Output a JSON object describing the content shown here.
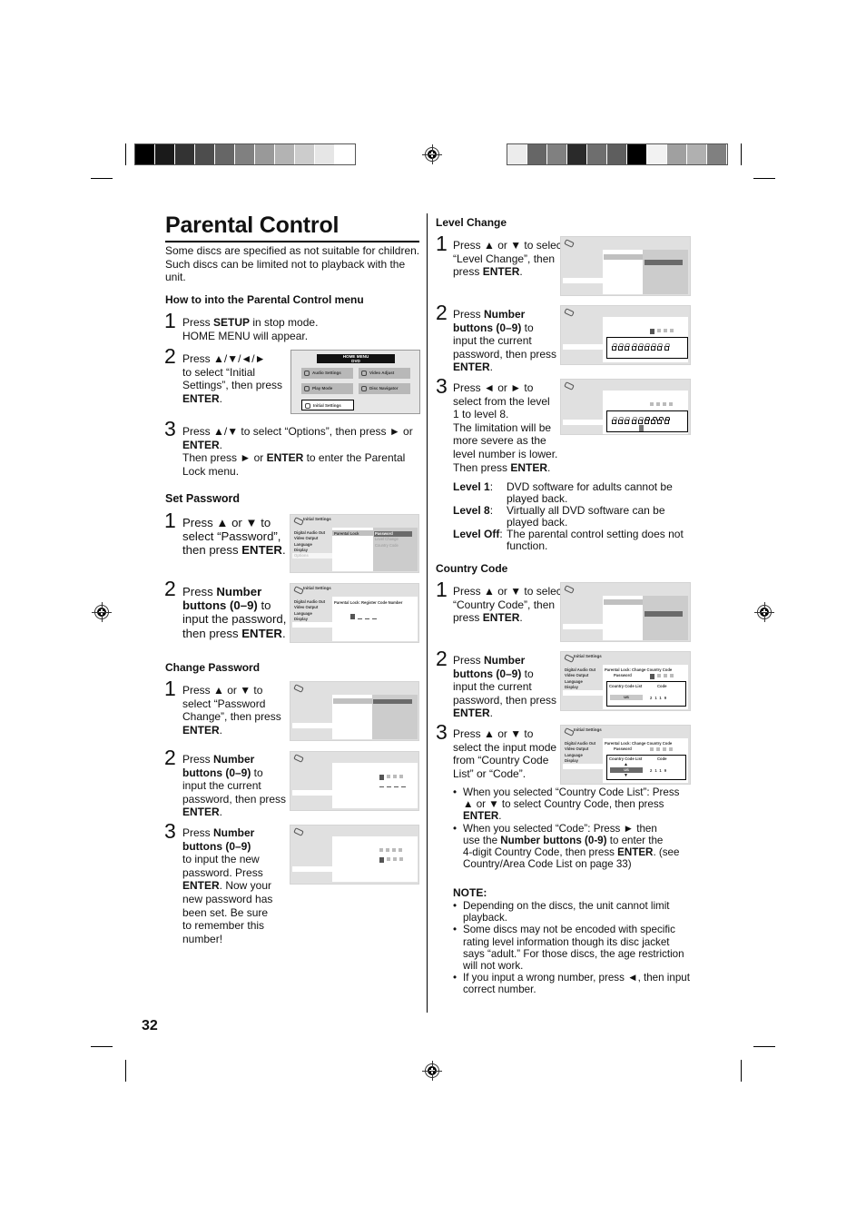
{
  "page": {
    "title": "Parental Control",
    "intro": "Some discs are specified as not suitable for children. Such discs can be limited not to playback with the unit.",
    "page_number": "32",
    "swatches_left": [
      "#000000",
      "#1a1a1a",
      "#333333",
      "#4d4d4d",
      "#666666",
      "#808080",
      "#999999",
      "#b3b3b3",
      "#cccccc",
      "#e6e6e6",
      "#ffffff"
    ],
    "swatches_right": [
      "#ececec",
      "#666666",
      "#808080",
      "#2a2a2a",
      "#6e6e6e",
      "#5e5e5e",
      "#000000",
      "#f2f2f2",
      "#a0a0a0",
      "#b0b0b0",
      "#808080"
    ]
  },
  "how_to": {
    "heading": "How to into the Parental Control menu",
    "steps": [
      {
        "num": "1",
        "pre": "Press ",
        "bold": "SETUP",
        "post": " in stop mode.",
        "line2": "HOME MENU will appear."
      },
      {
        "num": "2",
        "pre": "Press ▲/▼/◄/►",
        "line2": "to select “Initial",
        "line3": "Settings”, then press",
        "bold": "ENTER",
        "post": "."
      },
      {
        "num": "3",
        "pre": "Press ▲/▼ to select “Options”, then press ► or",
        "bold": "ENTER",
        "post": ".",
        "line3a": "Then press ► or ",
        "bold2": "ENTER",
        "line3b": " to enter the Parental",
        "line4": "Lock menu."
      }
    ],
    "home_menu": {
      "title": "HOME MENU",
      "subtitle": "DVD",
      "buttons": [
        "Audio Settings",
        "Video Adjust",
        "Play Mode",
        "Disc Navigator",
        "Initial Settings"
      ]
    }
  },
  "screen_common": {
    "title": "Initial Settings",
    "side_items": [
      "Digital Audio Out",
      "Video Output",
      "Language",
      "Display",
      "Options"
    ],
    "parental_lock": "Parental Lock",
    "sub_items": [
      "Password",
      "Level Change",
      "Country Code"
    ],
    "register_code": "Parental Lock: Register Code Number",
    "change_country": "Parental Lock: Change Country Code",
    "password_label": "Password",
    "country_list_label": "Country Code List",
    "code_label": "Code",
    "country_value": "US",
    "code_digits": [
      "2",
      "1",
      "1",
      "9"
    ]
  },
  "set_password": {
    "heading": "Set Password",
    "step1": {
      "num": "1",
      "l1": "Press ▲ or ▼ to",
      "l2": "select “Password”,",
      "l3": "then press ",
      "bold": "ENTER",
      "post": "."
    },
    "step2": {
      "num": "2",
      "l1a": "Press ",
      "bold1": "Number",
      "bold2": "buttons (0–9)",
      "l2b": " to",
      "l3": "input the password,",
      "l4": "then press ",
      "bold3": "ENTER",
      "post": "."
    }
  },
  "change_password": {
    "heading": "Change Password",
    "step1": {
      "num": "1",
      "l1": "Press ▲ or ▼ to",
      "l2": "select “Password",
      "l3": "Change”, then press",
      "bold": "ENTER",
      "post": "."
    },
    "step2": {
      "num": "2",
      "l1": "Press ",
      "bold1": "Number",
      "bold2": "buttons (0–9)",
      "l2b": " to",
      "l3": "input the current",
      "l4": "password, then press",
      "bold3": "ENTER",
      "post": "."
    },
    "step3": {
      "num": "3",
      "l1": "Press ",
      "bold1": "Number",
      "bold2": "buttons (0–9)",
      "l3": "to input the new",
      "l4": "password. Press",
      "bold3": "ENTER",
      "l5b": ". Now your",
      "l6": "new password has",
      "l7": "been set. Be sure",
      "l8": "to remember this",
      "l9": "number!"
    }
  },
  "level_change": {
    "heading": "Level Change",
    "step1": {
      "num": "1",
      "l1": "Press ▲ or ▼ to select",
      "l2": "“Level Change”, then",
      "l3": "press ",
      "bold": "ENTER",
      "post": "."
    },
    "step2": {
      "num": "2",
      "l1": "Press ",
      "bold1": "Number",
      "bold2": "buttons (0–9)",
      "l2b": " to",
      "l3": "input the current",
      "l4": "password, then press",
      "bold3": "ENTER",
      "post": "."
    },
    "step3": {
      "num": "3",
      "l1": "Press ◄ or ► to",
      "l2": "select from the level",
      "l3": "1 to level 8.",
      "l4": "The limitation will be",
      "l5": "more severe as the",
      "l6": "level number is lower.",
      "l7": "Then press ",
      "bold": "ENTER",
      "post": "."
    },
    "selected_level": 5,
    "levels": [
      {
        "key": "Level 1",
        "sep": ":",
        "desc": "DVD software for adults cannot be played back."
      },
      {
        "key": "Level 8",
        "sep": ":",
        "desc": "Virtually all DVD software can be played back."
      },
      {
        "key": "Level Off",
        "sep": ":",
        "desc": "The parental control setting does not function."
      }
    ]
  },
  "country_code": {
    "heading": "Country Code",
    "step1": {
      "num": "1",
      "l1": "Press ▲ or ▼ to select",
      "l2": "“Country Code”, then",
      "l3": "press ",
      "bold": "ENTER",
      "post": "."
    },
    "step2": {
      "num": "2",
      "l1": "Press ",
      "bold1": "Number",
      "bold2": "buttons (0–9)",
      "l2b": " to",
      "l3": "input the current",
      "l4": "password, then press",
      "bold3": "ENTER",
      "post": "."
    },
    "step3": {
      "num": "3",
      "l1": "Press ▲ or ▼ to",
      "l2": "select the input mode",
      "l3": "from “Country Code",
      "l4": "List” or “Code”."
    },
    "bullets": [
      {
        "a": "When you selected “Country Code List”: Press",
        "b": "▲ or ▼ to select Country Code, then press",
        "bold": "ENTER",
        "post": "."
      },
      {
        "a": "When you selected “Code”: Press ► then",
        "b1": "use the ",
        "bold": "Number buttons (0-9)",
        "b2": " to enter the",
        "c1": "4-digit Country Code, then press ",
        "bold2": "ENTER",
        "c2": ". (see",
        "d": "Country/Area Code List on page 33)"
      }
    ]
  },
  "note": {
    "heading": "NOTE:",
    "items": [
      [
        "Depending on the discs, the unit cannot limit",
        "playback."
      ],
      [
        "Some discs may not be encoded with specific",
        "rating level information though its disc jacket",
        "says “adult.” For those discs, the age restriction",
        "will not work."
      ],
      [
        "If you input a wrong number, press ◄, then input",
        "correct number."
      ]
    ]
  }
}
